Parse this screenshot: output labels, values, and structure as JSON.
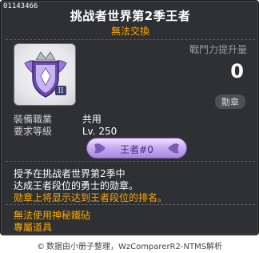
{
  "tooltip": {
    "item_id": "01143466",
    "item_name": "挑战者世界第2季王者",
    "trade_status": "無法交換",
    "power_label": "戰鬥力提升量",
    "power_value": "0",
    "category": "勳章",
    "requirements": [
      {
        "key": "裝備職業",
        "value": "共用"
      },
      {
        "key": "要求等級",
        "value": "Lv. 250"
      }
    ],
    "medal_title": "王者#0",
    "description_lines": [
      "授予在挑战者世界第2季中",
      "达成王者段位的勇士的勋章。"
    ],
    "note_line": "勋章上将显示达到王者段位的排名。",
    "restrictions": [
      "無法使用神秘鐵砧",
      "專屬道具"
    ]
  },
  "footer": {
    "copyright_icon": "©",
    "text": "数据由小册子整理，WzComparerR2-NTMS解析"
  },
  "colors": {
    "background": "#2e3033",
    "accent_orange": "#ffaa00",
    "medal_purple": "#a888e0"
  }
}
